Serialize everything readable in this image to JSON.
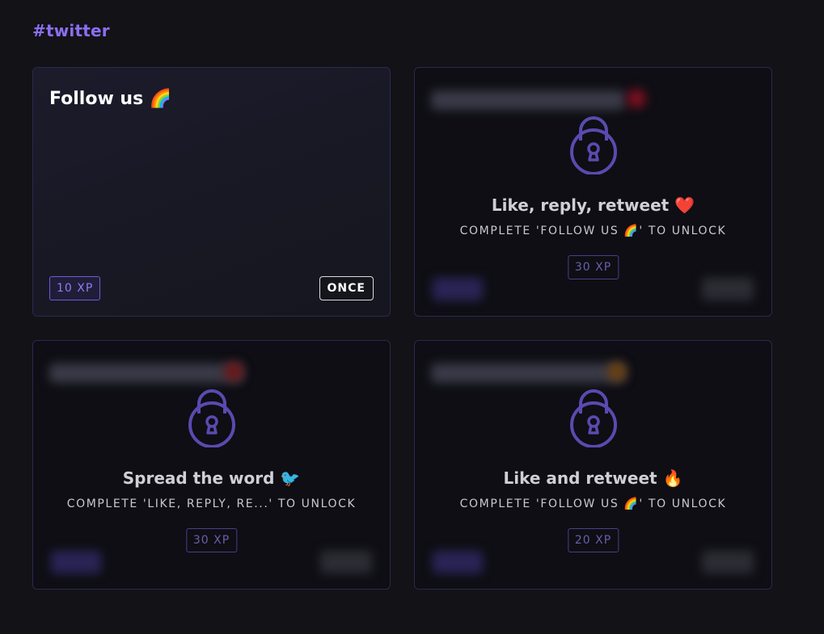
{
  "section": {
    "title": "#twitter"
  },
  "cards": [
    {
      "title": "Follow us 🌈",
      "xp": "10 XP",
      "frequency": "ONCE",
      "locked": false
    },
    {
      "title": "Like, reply, retweet ❤️",
      "unlock_text": "COMPLETE 'FOLLOW US 🌈' TO UNLOCK",
      "xp": "30 XP",
      "locked": true,
      "icon": "lock-icon"
    },
    {
      "title": "Spread the word 🐦",
      "unlock_text": "COMPLETE 'LIKE, REPLY, RE...' TO UNLOCK",
      "xp": "30 XP",
      "locked": true,
      "icon": "lock-icon"
    },
    {
      "title": "Like and retweet 🔥",
      "unlock_text": "COMPLETE 'FOLLOW US 🌈' TO UNLOCK",
      "xp": "20 XP",
      "locked": true,
      "icon": "lock-icon"
    }
  ],
  "colors": {
    "accent": "#8b6ff0",
    "lock": "#5a4ab0",
    "background": "#121217"
  }
}
